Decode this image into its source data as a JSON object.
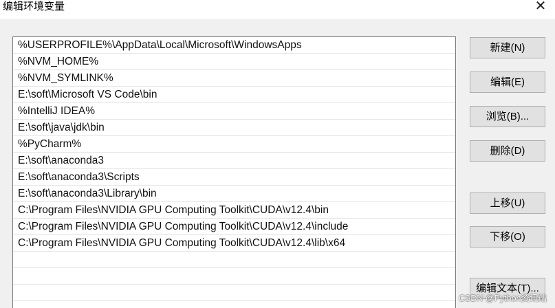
{
  "window": {
    "title": "编辑环境变量",
    "close_glyph": "✕"
  },
  "paths": [
    "%USERPROFILE%\\AppData\\Local\\Microsoft\\WindowsApps",
    "%NVM_HOME%",
    "%NVM_SYMLINK%",
    "E:\\soft\\Microsoft VS Code\\bin",
    "%IntelliJ IDEA%",
    "E:\\soft\\java\\jdk\\bin",
    "%PyCharm%",
    "E:\\soft\\anaconda3",
    "E:\\soft\\anaconda3\\Scripts",
    "E:\\soft\\anaconda3\\Library\\bin",
    "C:\\Program Files\\NVIDIA GPU Computing Toolkit\\CUDA\\v12.4\\bin",
    "C:\\Program Files\\NVIDIA GPU Computing Toolkit\\CUDA\\v12.4\\include",
    "C:\\Program Files\\NVIDIA GPU Computing Toolkit\\CUDA\\v12.4\\lib\\x64",
    "",
    "",
    "",
    ""
  ],
  "buttons": {
    "new": "新建(N)",
    "edit": "编辑(E)",
    "browse": "浏览(B)...",
    "delete": "删除(D)",
    "move_up": "上移(U)",
    "move_down": "下移(O)",
    "edit_text": "编辑文本(T)..."
  },
  "watermark": "CSDN @Python资讯站"
}
